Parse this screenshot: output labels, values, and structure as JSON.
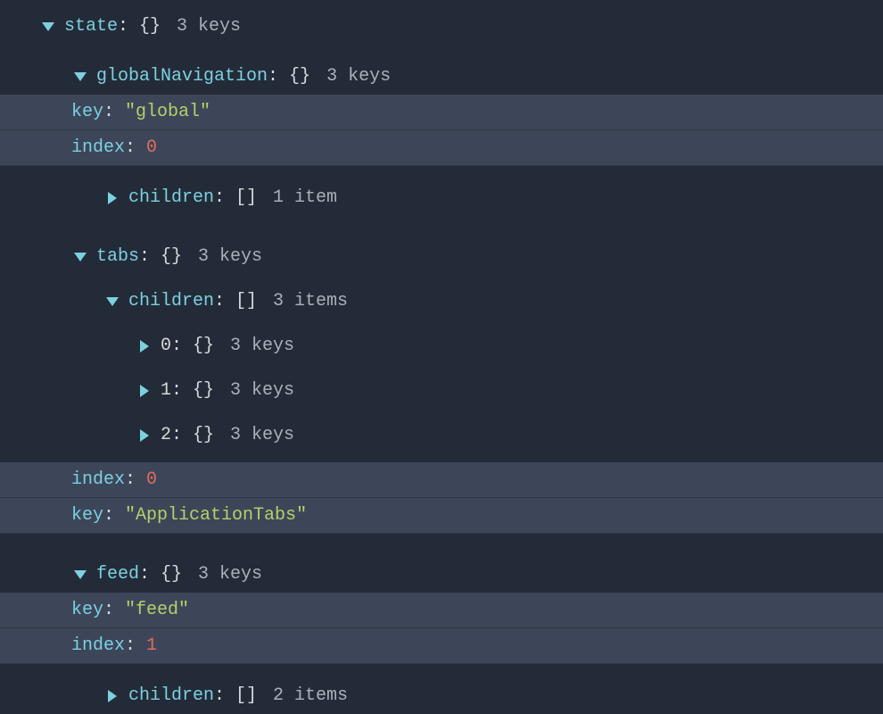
{
  "root": {
    "label": "state",
    "brace": "{}",
    "meta": "3 keys"
  },
  "globalNav": {
    "label": "globalNavigation",
    "brace": "{}",
    "meta": "3 keys",
    "keyRow": {
      "k": "key",
      "v": "\"global\""
    },
    "indexRow": {
      "k": "index",
      "v": "0"
    },
    "children": {
      "label": "children",
      "brace": "[]",
      "meta": "1 item"
    }
  },
  "tabs": {
    "label": "tabs",
    "brace": "{}",
    "meta": "3 keys",
    "children": {
      "label": "children",
      "brace": "[]",
      "meta": "3 items",
      "items": [
        {
          "idx": "0",
          "brace": "{}",
          "meta": "3 keys"
        },
        {
          "idx": "1",
          "brace": "{}",
          "meta": "3 keys"
        },
        {
          "idx": "2",
          "brace": "{}",
          "meta": "3 keys"
        }
      ]
    },
    "indexRow": {
      "k": "index",
      "v": "0"
    },
    "keyRow": {
      "k": "key",
      "v": "\"ApplicationTabs\""
    }
  },
  "feed": {
    "label": "feed",
    "brace": "{}",
    "meta": "3 keys",
    "keyRow": {
      "k": "key",
      "v": "\"feed\""
    },
    "indexRow": {
      "k": "index",
      "v": "1"
    },
    "children": {
      "label": "children",
      "brace": "[]",
      "meta": "2 items"
    }
  }
}
